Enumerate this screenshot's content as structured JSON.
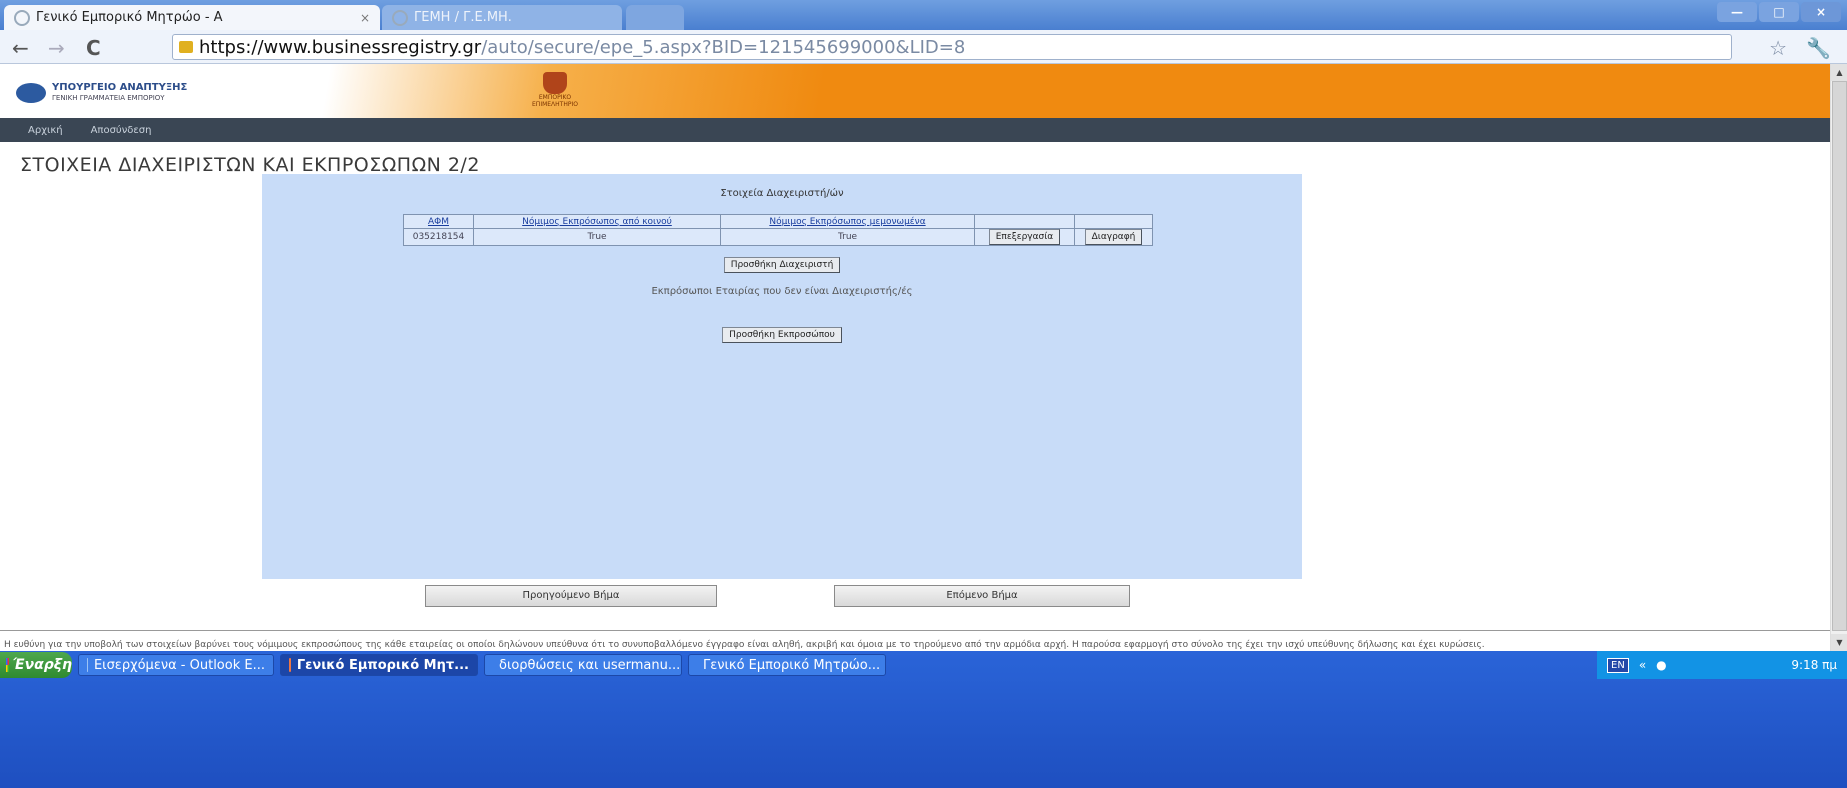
{
  "browser": {
    "tabs": [
      {
        "label": "Γενικό Εμπορικό Μητρώο - Α",
        "close": "×"
      },
      {
        "label": "ΓΕΜΗ / Γ.Ε.ΜΗ."
      }
    ],
    "url_host": "https://www.businessregistry.gr",
    "url_path": "/auto/secure/epe_5.aspx?BID=121545699000&LID=8",
    "window_buttons": {
      "minimize": "—",
      "maximize": "□",
      "close": "×"
    },
    "icons": {
      "back": "←",
      "forward": "→",
      "reload": "C",
      "star": "☆",
      "wrench": "🔧"
    }
  },
  "header": {
    "ministry": "ΥΠΟΥΡΓΕΙΟ ΑΝΑΠΤΥΞΗΣ",
    "ministry_sub": "ΓΕΝΙΚΗ ΓΡΑΜΜΑΤΕΙΑ ΕΜΠΟΡΙΟΥ",
    "emblem_text": "ΕΜΠΟΡΙΚΟ ΕΠΙΜΕΛΗΤΗΡΙΟ"
  },
  "menu": {
    "home": "Αρχική",
    "logout": "Αποσύνδεση"
  },
  "page": {
    "title": "ΣΤΟΙΧΕΙΑ ΔΙΑΧΕΙΡΙΣΤΩΝ ΚΑΙ ΕΚΠΡΟΣΩΠΩΝ 2/2"
  },
  "panel": {
    "heading": "Στοιχεία Διαχειριστή/ών",
    "table": {
      "headers": [
        "ΑΦΜ",
        "Νόμιμος Εκπρόσωπος από κοινού",
        "Νόμιμος Εκπρόσωπος μεμονωμένα",
        "",
        ""
      ],
      "row": {
        "afm": "035218154",
        "joint": "True",
        "single": "True",
        "edit": "Επεξεργασία",
        "delete": "Διαγραφή"
      }
    },
    "add_manager": "Προσθήκη Διαχειριστή",
    "reps_heading": "Εκπρόσωποι Εταιρίας που δεν είναι Διαχειριστής/ές",
    "add_rep": "Προσθήκη Εκπροσώπου"
  },
  "steps": {
    "prev": "Προηγούμενο Βήμα",
    "next": "Επόμενο Βήμα"
  },
  "footer": {
    "text": "Η ευθύνη για την υποβολή των στοιχείων βαρύνει τους νόμιμους εκπροσώπους της κάθε εταιρείας οι οποίοι δηλώνουν υπεύθυνα ότι το συνυποβαλλόμενο έγγραφο είναι αληθή, ακριβή και όμοια με το τηρούμενο από την αρμόδια αρχή. Η παρούσα εφαρμογή στο σύνολο της έχει την ισχύ υπεύθυνης δήλωσης και έχει κυρώσεις."
  },
  "taskbar": {
    "start": "Έναρξη",
    "items": [
      {
        "label": "Εισερχόμενα - Outlook E..."
      },
      {
        "label": "Γενικό Εμπορικό Μητ..."
      },
      {
        "label": "διορθώσεις και usermanu..."
      },
      {
        "label": "Γενικό Εμπορικό Μητρώο..."
      }
    ],
    "lang": "EN",
    "clock": "9:18 πμ"
  }
}
